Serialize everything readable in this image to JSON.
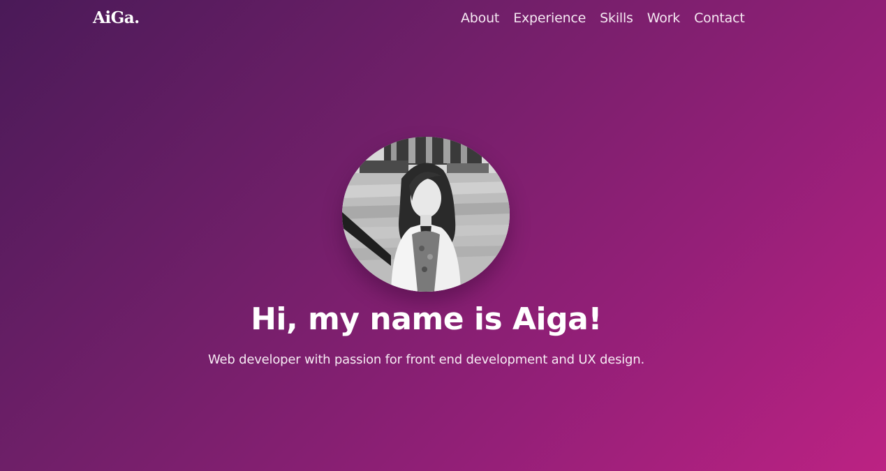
{
  "header": {
    "logo": "AiGa.",
    "nav": [
      {
        "label": "About"
      },
      {
        "label": "Experience"
      },
      {
        "label": "Skills"
      },
      {
        "label": "Work"
      },
      {
        "label": "Contact"
      }
    ]
  },
  "hero": {
    "title": "Hi, my name is Aiga!",
    "subtitle": "Web developer with passion for front end development and UX design."
  },
  "colors": {
    "gradient_start": "#4a1a58",
    "gradient_end": "#bc2283",
    "text": "#ffffff"
  }
}
